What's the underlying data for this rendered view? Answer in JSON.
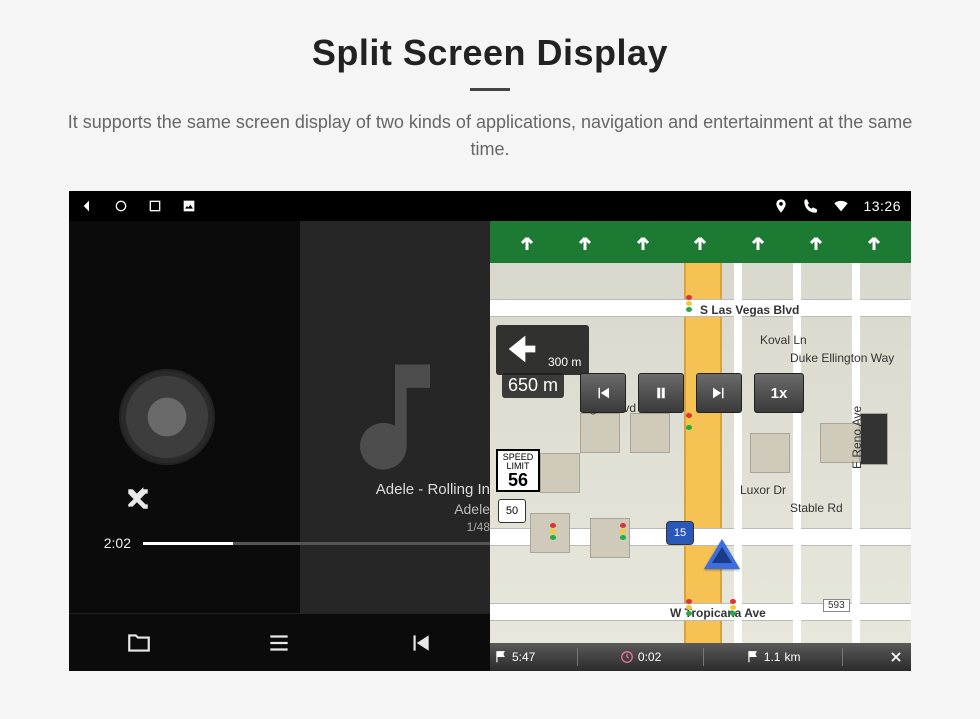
{
  "header": {
    "title": "Split Screen Display",
    "subtitle": "It supports the same screen display of two kinds of applications, navigation and entertainment at the same time."
  },
  "statusbar": {
    "time": "13:26"
  },
  "music": {
    "track_title": "Adele - Rolling In",
    "artist": "Adele",
    "position": "1/48",
    "elapsed": "2:02"
  },
  "nav": {
    "turn_sub_distance": "300",
    "turn_sub_unit": "m",
    "turn_main": "650 m",
    "speed_button": "1x",
    "speed_limit_label": "SPEED LIMIT",
    "speed_limit_value": "56",
    "route_50": "50",
    "route_15": "15",
    "street_vegas": "S Las Vegas Blvd",
    "street_koval": "Koval Ln",
    "street_duke": "Duke Ellington Way",
    "street_vegas2": "/egas Blvd",
    "street_luxor": "Luxor Dr",
    "street_stable": "Stable Rd",
    "street_reno": "E Reno Ave",
    "street_tropicana": "W Tropicana Ave",
    "harmon_flag": "593",
    "eta": "5:47",
    "time_remaining": "0:02",
    "dist_remaining": "1.1",
    "dist_unit": "km"
  }
}
